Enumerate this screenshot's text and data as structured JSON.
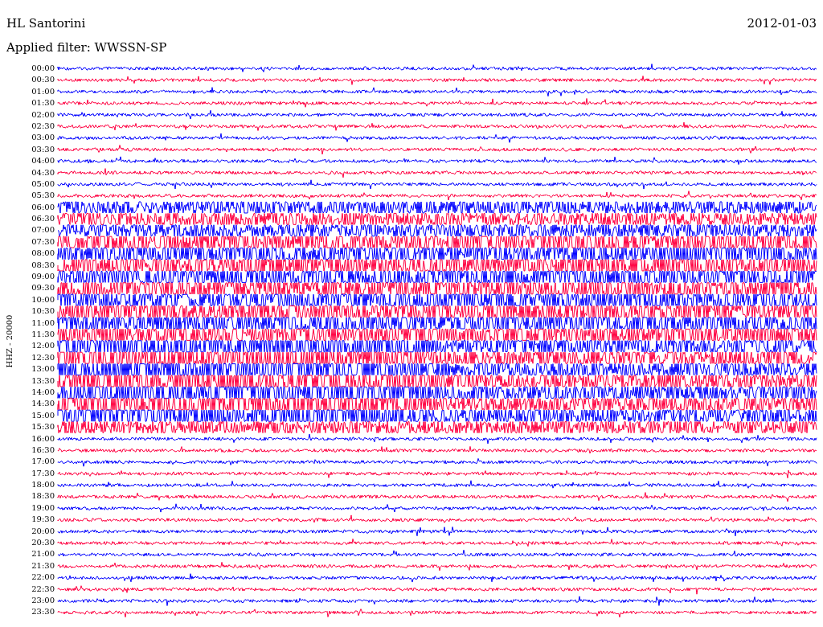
{
  "station": "HL Santorini",
  "date": "2012-01-03",
  "filter": "Applied filter: WWSSN-SP",
  "axis_label": "HHZ - 20000",
  "traces": [
    {
      "time": "00:00",
      "color": "#0000ff"
    },
    {
      "time": "00:30",
      "color": "#ff0040"
    },
    {
      "time": "01:00",
      "color": "#0000ff"
    },
    {
      "time": "01:30",
      "color": "#ff0040"
    },
    {
      "time": "02:00",
      "color": "#0000ff"
    },
    {
      "time": "02:30",
      "color": "#ff0040"
    },
    {
      "time": "03:00",
      "color": "#0000ff"
    },
    {
      "time": "03:30",
      "color": "#ff0040"
    },
    {
      "time": "04:00",
      "color": "#0000ff"
    },
    {
      "time": "04:30",
      "color": "#ff0040"
    },
    {
      "time": "05:00",
      "color": "#0000ff"
    },
    {
      "time": "05:30",
      "color": "#ff0040"
    },
    {
      "time": "06:00",
      "color": "#0000ff"
    },
    {
      "time": "06:30",
      "color": "#ff0040"
    },
    {
      "time": "07:00",
      "color": "#0000ff"
    },
    {
      "time": "07:30",
      "color": "#ff0040"
    },
    {
      "time": "08:00",
      "color": "#0000ff"
    },
    {
      "time": "08:30",
      "color": "#ff0040"
    },
    {
      "time": "09:00",
      "color": "#0000ff"
    },
    {
      "time": "09:30",
      "color": "#ff0040"
    },
    {
      "time": "10:00",
      "color": "#0000ff"
    },
    {
      "time": "10:30",
      "color": "#ff0040"
    },
    {
      "time": "11:00",
      "color": "#0000ff"
    },
    {
      "time": "11:30",
      "color": "#ff0040"
    },
    {
      "time": "12:00",
      "color": "#0000ff"
    },
    {
      "time": "12:30",
      "color": "#ff0040"
    },
    {
      "time": "13:00",
      "color": "#0000ff"
    },
    {
      "time": "13:30",
      "color": "#ff0040"
    },
    {
      "time": "14:00",
      "color": "#0000ff"
    },
    {
      "time": "14:30",
      "color": "#ff0040"
    },
    {
      "time": "15:00",
      "color": "#0000ff"
    },
    {
      "time": "15:30",
      "color": "#ff0040"
    },
    {
      "time": "16:00",
      "color": "#0000ff"
    },
    {
      "time": "16:30",
      "color": "#ff0040"
    },
    {
      "time": "17:00",
      "color": "#0000ff"
    },
    {
      "time": "17:30",
      "color": "#ff0040"
    },
    {
      "time": "18:00",
      "color": "#0000ff"
    },
    {
      "time": "18:30",
      "color": "#ff0040"
    },
    {
      "time": "19:00",
      "color": "#0000ff"
    },
    {
      "time": "19:30",
      "color": "#ff0040"
    },
    {
      "time": "20:00",
      "color": "#0000ff"
    },
    {
      "time": "20:30",
      "color": "#ff0040"
    },
    {
      "time": "21:00",
      "color": "#0000ff"
    },
    {
      "time": "21:30",
      "color": "#ff0040"
    },
    {
      "time": "22:00",
      "color": "#0000ff"
    },
    {
      "time": "22:30",
      "color": "#ff0040"
    },
    {
      "time": "23:00",
      "color": "#0000ff"
    },
    {
      "time": "23:30",
      "color": "#ff0040"
    }
  ]
}
